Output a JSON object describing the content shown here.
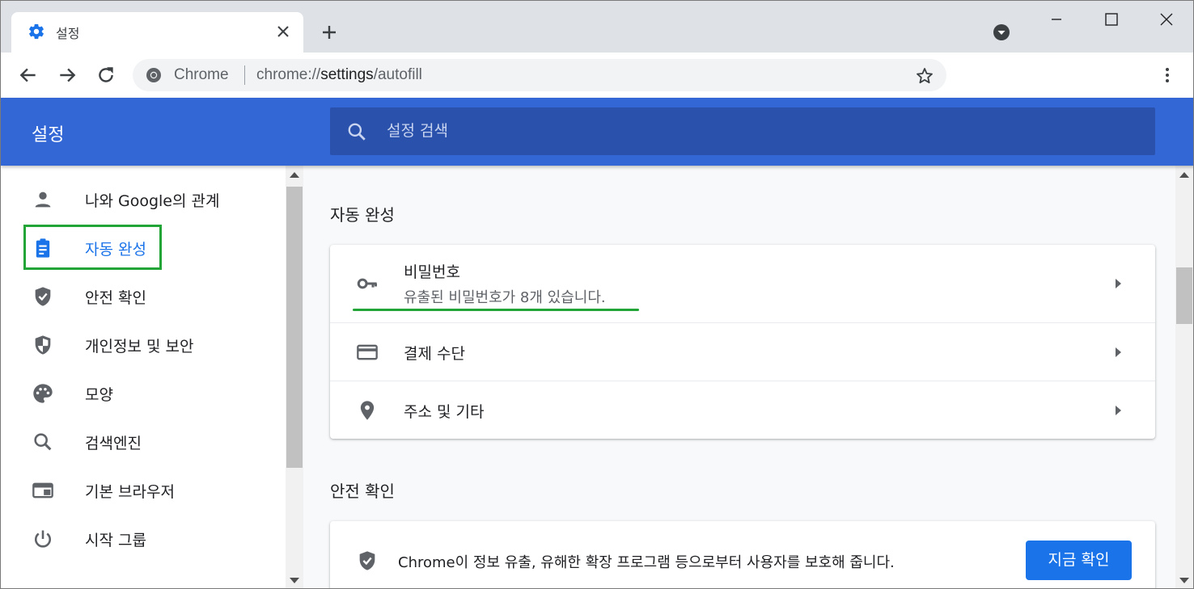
{
  "browser": {
    "tab": {
      "title": "설정",
      "icon": "gear-icon"
    },
    "omnibox": {
      "site_label": "Chrome",
      "url_scheme": "chrome://",
      "url_host": "settings",
      "url_path": "/autofill"
    }
  },
  "settings": {
    "header_title": "설정",
    "search_placeholder": "설정 검색"
  },
  "sidebar": {
    "items": [
      {
        "label": "나와 Google의 관계",
        "icon": "person-icon"
      },
      {
        "label": "자동 완성",
        "icon": "clipboard-icon",
        "active": true
      },
      {
        "label": "안전 확인",
        "icon": "shield-check-icon"
      },
      {
        "label": "개인정보 및 보안",
        "icon": "shield-half-icon"
      },
      {
        "label": "모양",
        "icon": "palette-icon"
      },
      {
        "label": "검색엔진",
        "icon": "search-icon"
      },
      {
        "label": "기본 브라우저",
        "icon": "browser-window-icon"
      },
      {
        "label": "시작 그룹",
        "icon": "power-icon"
      }
    ]
  },
  "autofill": {
    "section_title": "자동 완성",
    "rows": [
      {
        "label": "비밀번호",
        "sublabel": "유출된 비밀번호가 8개 있습니다.",
        "icon": "key-icon"
      },
      {
        "label": "결제 수단",
        "icon": "credit-card-icon"
      },
      {
        "label": "주소 및 기타",
        "icon": "location-pin-icon"
      }
    ]
  },
  "safety_check": {
    "section_title": "안전 확인",
    "description": "Chrome이 정보 유출, 유해한 확장 프로그램 등으로부터 사용자를 보호해 줍니다.",
    "button_label": "지금 확인",
    "icon": "shield-check-icon"
  },
  "colors": {
    "header_blue": "#3367d6",
    "search_bg": "#2a51ab",
    "accent": "#1a73e8",
    "highlight_green": "#22a437"
  }
}
